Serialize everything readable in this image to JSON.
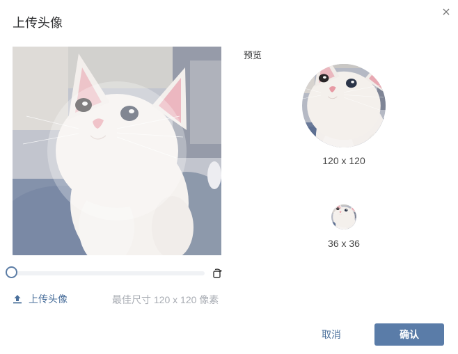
{
  "dialog": {
    "title": "上传头像",
    "close_icon": "close-icon"
  },
  "cropper": {
    "image": "cat-photo",
    "zoom": 0
  },
  "preview": {
    "label": "预览",
    "large_caption": "120 x 120",
    "small_caption": "36 x 36"
  },
  "upload": {
    "icon": "upload-icon",
    "label": "上传头像",
    "hint": "最佳尺寸 120 x 120 像素"
  },
  "actions": {
    "cancel_label": "取消",
    "confirm_label": "确认"
  },
  "colors": {
    "accent": "#5a7ca8",
    "link": "#4a6f9b",
    "hint": "#a8acb3"
  }
}
